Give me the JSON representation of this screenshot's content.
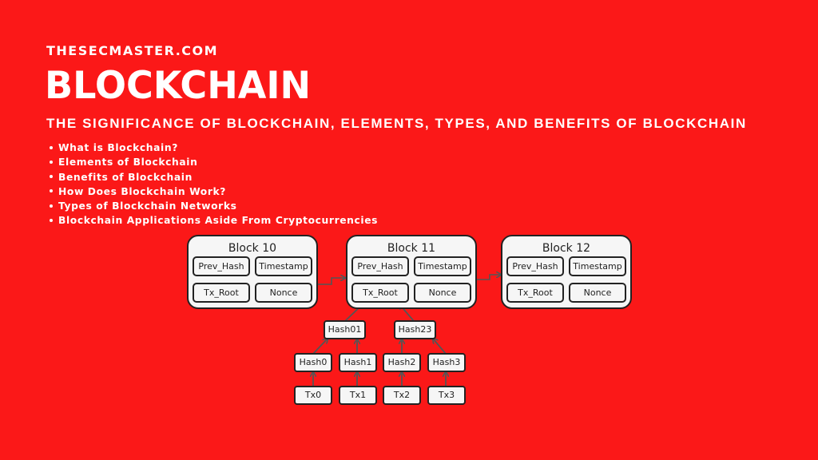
{
  "header": {
    "site": "THESECMASTER.COM",
    "title": "BLOCKCHAIN",
    "subtitle": "THE SIGNIFICANCE OF BLOCKCHAIN, ELEMENTS, TYPES, AND BENEFITS OF BLOCKCHAIN"
  },
  "toc": [
    "What is Blockchain?",
    "Elements of Blockchain",
    "Benefits of Blockchain",
    "How Does Blockchain Work?",
    "Types of Blockchain Networks",
    "Blockchain Applications Aside From Cryptocurrencies"
  ],
  "colors": {
    "background": "#fb1818",
    "box_fill": "#f6f6f6",
    "box_border": "#222222",
    "connector": "#555555"
  },
  "diagram": {
    "blocks": [
      {
        "title": "Block 10",
        "fields": [
          "Prev_Hash",
          "Timestamp",
          "Tx_Root",
          "Nonce"
        ]
      },
      {
        "title": "Block 11",
        "fields": [
          "Prev_Hash",
          "Timestamp",
          "Tx_Root",
          "Nonce"
        ]
      },
      {
        "title": "Block 12",
        "fields": [
          "Prev_Hash",
          "Timestamp",
          "Tx_Root",
          "Nonce"
        ]
      }
    ],
    "merkle": {
      "level1": [
        "Hash01",
        "Hash23"
      ],
      "level2": [
        "Hash0",
        "Hash1",
        "Hash2",
        "Hash3"
      ],
      "leaves": [
        "Tx0",
        "Tx1",
        "Tx2",
        "Tx3"
      ]
    }
  }
}
